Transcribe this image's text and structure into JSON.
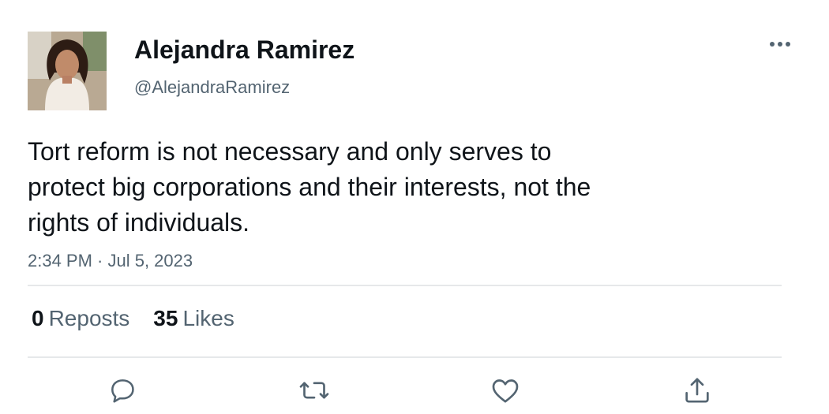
{
  "author": {
    "name": "Alejandra Ramirez",
    "handle": "@AlejandraRamirez",
    "avatar": "profile-photo"
  },
  "tweet": {
    "text_lines": [
      "Tort reform is not necessary and only serves to",
      "protect big corporations and their interests, not the",
      "rights of individuals."
    ],
    "timestamp": "2:34 PM · Jul 5, 2023"
  },
  "stats": {
    "reposts_count": "0",
    "reposts_label": "Reposts",
    "likes_count": "35",
    "likes_label": "Likes"
  },
  "actions": [
    "reply-icon",
    "repost-icon",
    "like-icon",
    "share-icon"
  ],
  "colors": {
    "text": "#0f1419",
    "secondary": "#536471",
    "divider": "#e6e8ea"
  }
}
